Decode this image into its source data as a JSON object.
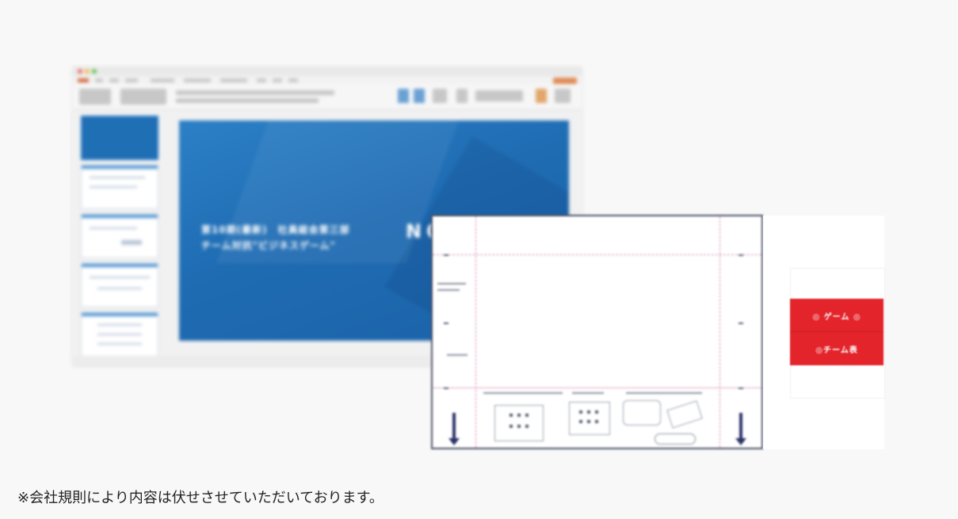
{
  "mockup": {
    "slide": {
      "title_line_1": "第10期(最新)　社員総会第三部",
      "title_line_2": "チーム対抗\"ビジネスゲーム\"",
      "logo_text": "NO"
    },
    "side_panel": {
      "label_1": "◎ ゲーム ◎",
      "label_2": "◎チーム表"
    },
    "colors": {
      "slide_blue": "#1f6cb3",
      "side_red": "#e3242b",
      "template_border": "#4a4f63",
      "fold_line": "#d98ab3"
    }
  },
  "caption": "※会社規則により内容は伏せさせていただいております。"
}
